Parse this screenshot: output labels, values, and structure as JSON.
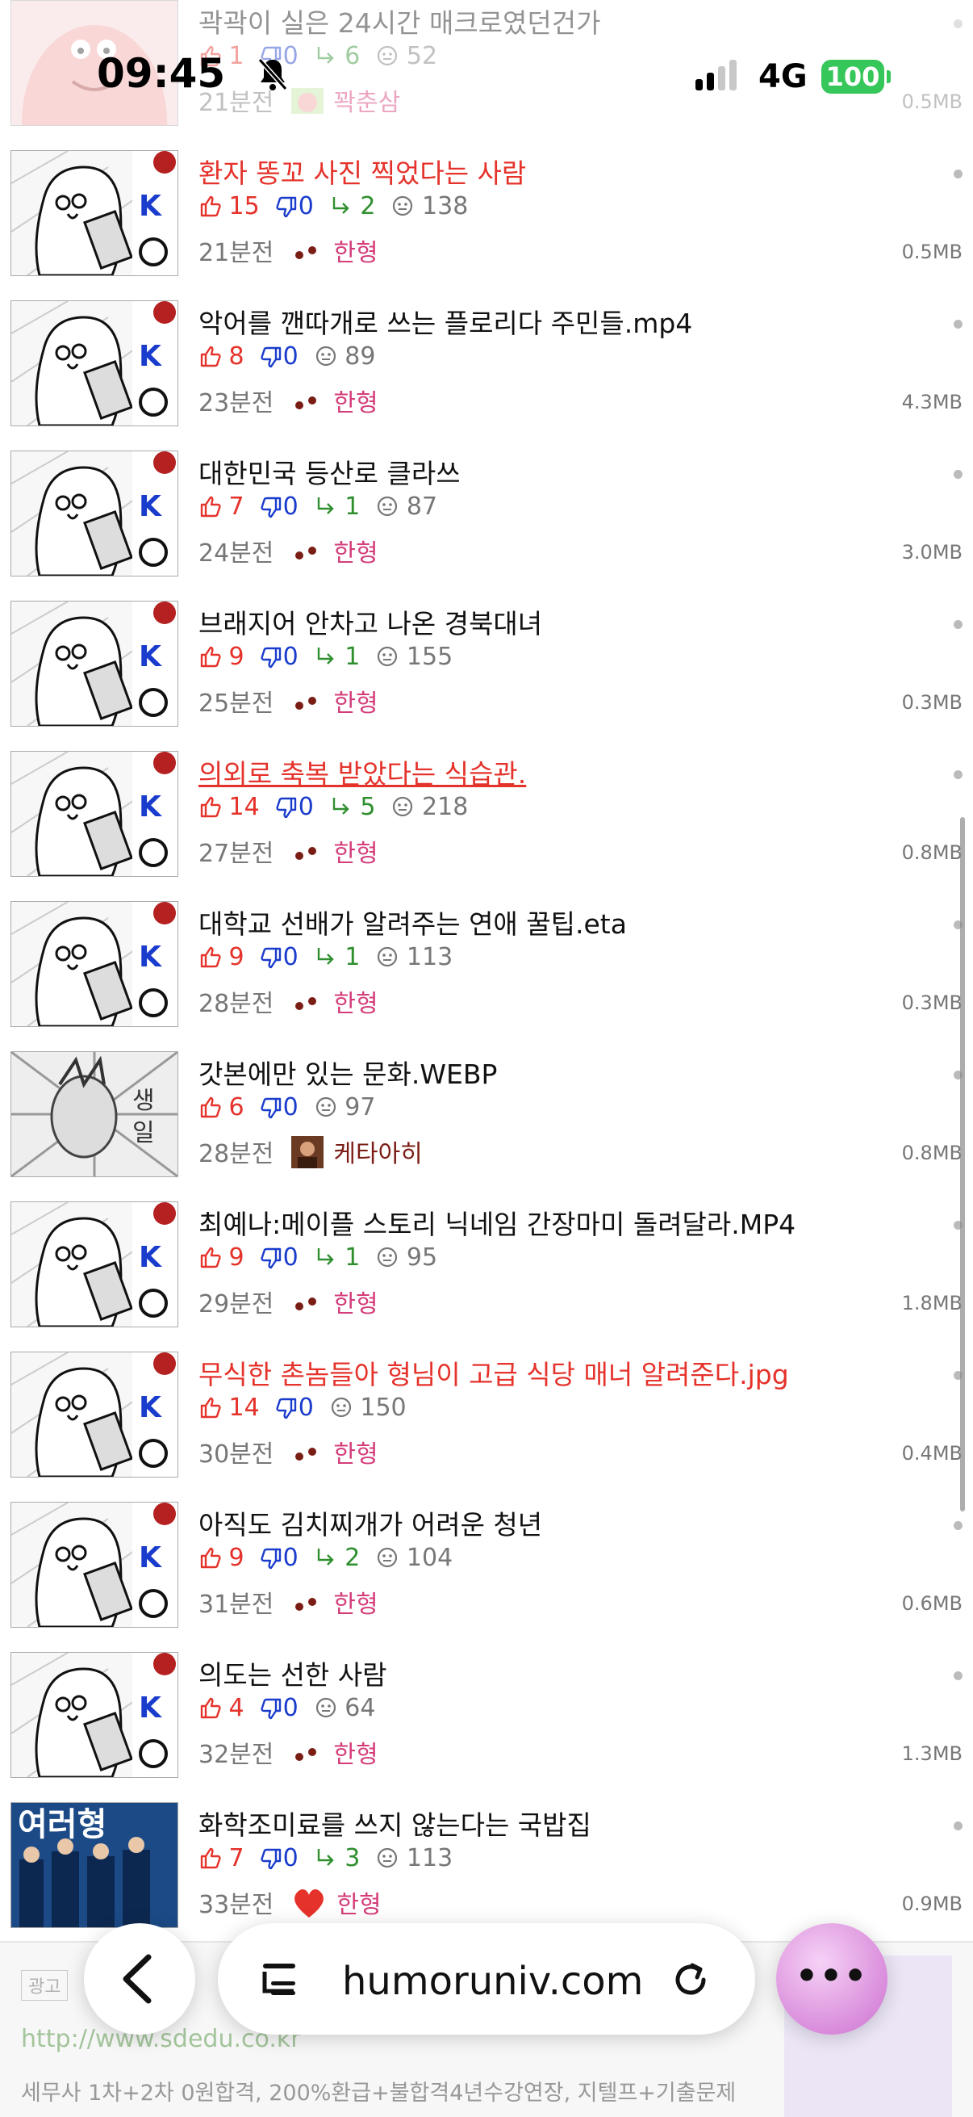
{
  "status_bar": {
    "time": "09:45",
    "network": "4G",
    "battery": "100"
  },
  "posts": [
    {
      "title": "곽곽이 실은 24시간 매크로였던건가",
      "red": false,
      "underline": false,
      "up": "1",
      "down": "0",
      "reply": "6",
      "views": "52",
      "time": "21분전",
      "nick": "꽉춘삼",
      "size": "0.5MB",
      "thumb": "patrick",
      "avatar": "patrick",
      "faded": true
    },
    {
      "title": "환자 똥꼬 사진 찍었다는 사람",
      "red": true,
      "underline": false,
      "up": "15",
      "down": "0",
      "reply": "2",
      "views": "138",
      "time": "21분전",
      "nick": "한형",
      "size": "0.5MB",
      "thumb": "cartoon",
      "avatar": "dots",
      "faded": false
    },
    {
      "title": "악어를 깬따개로 쓰는 플로리다 주민들.mp4",
      "red": false,
      "underline": false,
      "up": "8",
      "down": "0",
      "reply": null,
      "views": "89",
      "time": "23분전",
      "nick": "한형",
      "size": "4.3MB",
      "thumb": "cartoon",
      "avatar": "dots",
      "faded": false
    },
    {
      "title": "대한민국 등산로 클라쓰",
      "red": false,
      "underline": false,
      "up": "7",
      "down": "0",
      "reply": "1",
      "views": "87",
      "time": "24분전",
      "nick": "한형",
      "size": "3.0MB",
      "thumb": "cartoon",
      "avatar": "dots",
      "faded": false
    },
    {
      "title": "브래지어 안차고 나온 경북대녀",
      "red": false,
      "underline": false,
      "up": "9",
      "down": "0",
      "reply": "1",
      "views": "155",
      "time": "25분전",
      "nick": "한형",
      "size": "0.3MB",
      "thumb": "cartoon",
      "avatar": "dots",
      "faded": false
    },
    {
      "title": "의외로 축복 받았다는 식습관.",
      "red": true,
      "underline": true,
      "up": "14",
      "down": "0",
      "reply": "5",
      "views": "218",
      "time": "27분전",
      "nick": "한형",
      "size": "0.8MB",
      "thumb": "cartoon",
      "avatar": "dots",
      "faded": false
    },
    {
      "title": "대학교 선배가 알려주는 연애 꿀팁.eta",
      "red": false,
      "underline": false,
      "up": "9",
      "down": "0",
      "reply": "1",
      "views": "113",
      "time": "28분전",
      "nick": "한형",
      "size": "0.3MB",
      "thumb": "cartoon",
      "avatar": "dots",
      "faded": false
    },
    {
      "title": "갓본에만 있는 문화.WEBP",
      "red": false,
      "underline": false,
      "up": "6",
      "down": "0",
      "reply": null,
      "views": "97",
      "time": "28분전",
      "nick": "케타아히",
      "size": "0.8MB",
      "thumb": "manga",
      "avatar": "photo",
      "faded": false
    },
    {
      "title": "최예나:메이플 스토리 닉네임 간장마미 돌려달라.MP4",
      "red": false,
      "underline": false,
      "up": "9",
      "down": "0",
      "reply": "1",
      "views": "95",
      "time": "29분전",
      "nick": "한형",
      "size": "1.8MB",
      "thumb": "cartoon",
      "avatar": "dots",
      "faded": false
    },
    {
      "title": "무식한 촌놈들아 형님이 고급 식당 매너 알려준다.jpg",
      "red": true,
      "underline": false,
      "up": "14",
      "down": "0",
      "reply": null,
      "views": "150",
      "time": "30분전",
      "nick": "한형",
      "size": "0.4MB",
      "thumb": "cartoon",
      "avatar": "dots",
      "faded": false
    },
    {
      "title": "아직도 김치찌개가 어려운 청년",
      "red": false,
      "underline": false,
      "up": "9",
      "down": "0",
      "reply": "2",
      "views": "104",
      "time": "31분전",
      "nick": "한형",
      "size": "0.6MB",
      "thumb": "cartoon",
      "avatar": "dots",
      "faded": false
    },
    {
      "title": "의도는 선한 사람",
      "red": false,
      "underline": false,
      "up": "4",
      "down": "0",
      "reply": null,
      "views": "64",
      "time": "32분전",
      "nick": "한형",
      "size": "1.3MB",
      "thumb": "cartoon",
      "avatar": "dots",
      "faded": false
    },
    {
      "title": "화학조미료를 쓰지 않는다는 국밥집",
      "red": false,
      "underline": false,
      "up": "7",
      "down": "0",
      "reply": "3",
      "views": "113",
      "time": "33분전",
      "nick": "한형",
      "size": "0.9MB",
      "thumb": "magazine",
      "avatar": "heart",
      "faded": false
    }
  ],
  "ad": {
    "label": "광고",
    "link": "http://www.sdedu.co.kr",
    "text": "세무사 1차+2차 0원합격, 200%환급+불합격4년수강연장, 지텔프+기출문제"
  },
  "browser": {
    "url": "humoruniv.com"
  },
  "colors": {
    "up": "#e5322b",
    "down": "#1a3ccc",
    "reply": "#2f8f2f",
    "nick": "#d43d7a",
    "battery": "#35c759"
  }
}
